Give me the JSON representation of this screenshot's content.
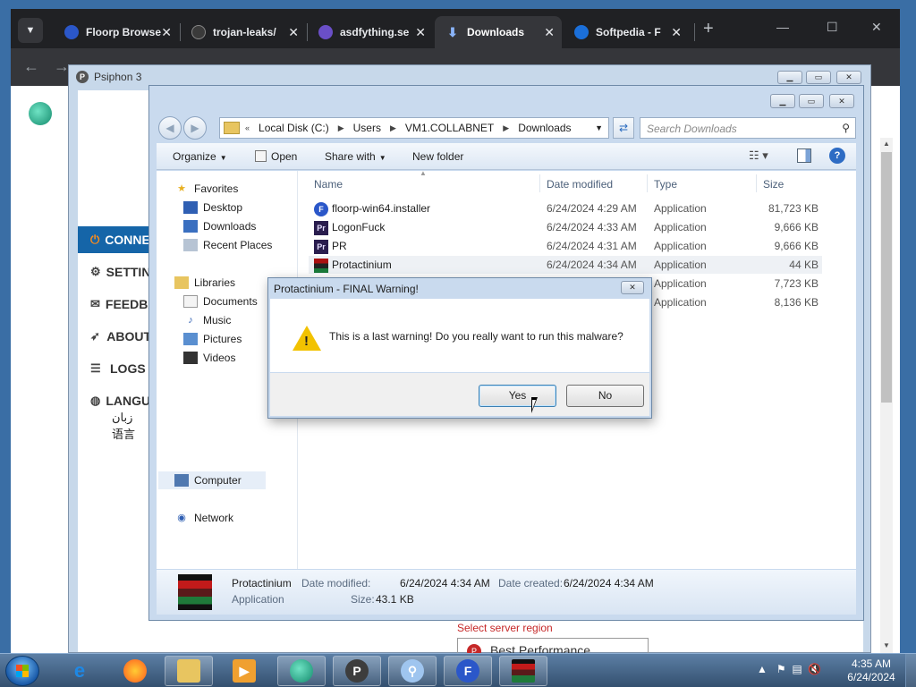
{
  "browser": {
    "tabs": [
      {
        "label": "Floorp Browse",
        "color": "#2b57c9"
      },
      {
        "label": "trojan-leaks/",
        "color": "#3a3a3a"
      },
      {
        "label": "asdfything.se",
        "color": "#6a4fc7"
      },
      {
        "label": "Downloads",
        "color": "#8ab4f8"
      },
      {
        "label": "Softpedia - F",
        "color": "#1b6fd9"
      }
    ],
    "active_tab": "Downloads",
    "new_tab": "+",
    "back_glyph": "←",
    "forward_glyph": "→"
  },
  "psiphon": {
    "title": "Psiphon 3",
    "nav": [
      {
        "label": "CONNECT",
        "icon": "power-icon"
      },
      {
        "label": "SETTINGS",
        "icon": "gear-icon"
      },
      {
        "label": "FEEDBACK",
        "icon": "chat-icon"
      },
      {
        "label": "ABOUT",
        "icon": "rocket-icon"
      },
      {
        "label": "LOGS",
        "icon": "list-icon"
      },
      {
        "label": "LANGUAGE",
        "icon": "globe-icon"
      }
    ],
    "language_extra": [
      "زبان",
      "语言"
    ],
    "region_label": "Select server region",
    "region_value": "Best Performance",
    "accent_color": "#1565a8"
  },
  "explorer": {
    "breadcrumb": [
      "Local Disk (C:)",
      "Users",
      "VM1.COLLABNET",
      "Downloads"
    ],
    "breadcrumb_prefix": "«",
    "search_placeholder": "Search Downloads",
    "commands": {
      "organize": "Organize",
      "open": "Open",
      "share_with": "Share with",
      "new_folder": "New folder"
    },
    "nav": {
      "favorites": {
        "label": "Favorites",
        "items": [
          "Desktop",
          "Downloads",
          "Recent Places"
        ]
      },
      "libraries": {
        "label": "Libraries",
        "items": [
          "Documents",
          "Music",
          "Pictures",
          "Videos"
        ]
      },
      "computer": "Computer",
      "network": "Network"
    },
    "columns": {
      "name": "Name",
      "date": "Date modified",
      "type": "Type",
      "size": "Size"
    },
    "files": [
      {
        "name": "floorp-win64.installer",
        "date": "6/24/2024 4:29 AM",
        "type": "Application",
        "size": "81,723 KB",
        "icon": "floorp-icon"
      },
      {
        "name": "LogonFuck",
        "date": "6/24/2024 4:33 AM",
        "type": "Application",
        "size": "9,666 KB",
        "icon": "premiere-icon"
      },
      {
        "name": "PR",
        "date": "6/24/2024 4:31 AM",
        "type": "Application",
        "size": "9,666 KB",
        "icon": "premiere-icon"
      },
      {
        "name": "Protactinium",
        "date": "6/24/2024 4:34 AM",
        "type": "Application",
        "size": "44 KB",
        "icon": "pixel-character-icon"
      },
      {
        "name": "",
        "date": "",
        "type": "Application",
        "size": "7,723 KB",
        "icon": ""
      },
      {
        "name": "",
        "date": "",
        "type": "Application",
        "size": "8,136 KB",
        "icon": ""
      }
    ],
    "details": {
      "name": "Protactinium",
      "type": "Application",
      "modified_label": "Date modified:",
      "modified_value": "6/24/2024 4:34 AM",
      "size_label": "Size:",
      "size_value": "43.1 KB",
      "created_label": "Date created:",
      "created_value": "6/24/2024 4:34 AM"
    }
  },
  "dialog": {
    "title": "Protactinium - FINAL Warning!",
    "message": "This is a last warning! Do you really want to run this malware?",
    "yes": "Yes",
    "no": "No"
  },
  "taskbar": {
    "clock_time": "4:35 AM",
    "clock_date": "6/24/2024",
    "apps": [
      "internet-explorer-icon",
      "firefox-icon",
      "file-explorer-icon",
      "media-player-icon",
      "psiphon-green-icon",
      "psiphon-p-icon",
      "magnifier-icon",
      "floorp-icon",
      "protactinium-icon"
    ]
  }
}
